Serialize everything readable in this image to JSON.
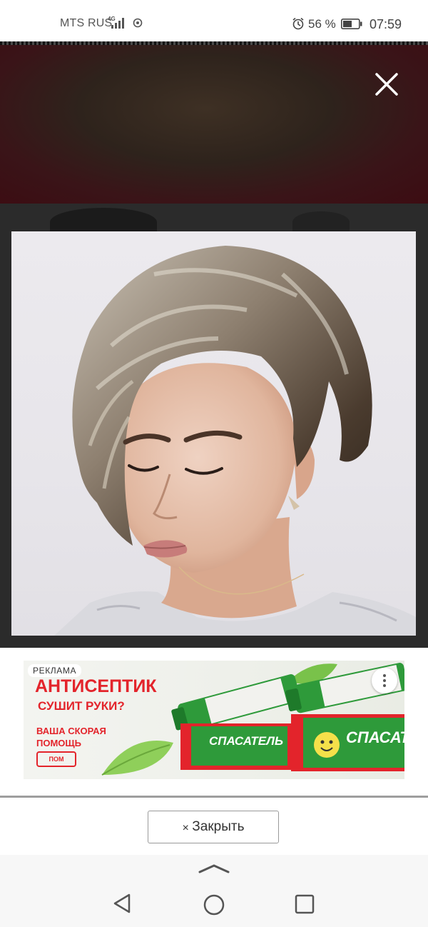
{
  "status_bar": {
    "carrier": "MTS RUS",
    "network": "4G",
    "battery_percent": "56 %",
    "battery_level": 56,
    "time": "07:59",
    "icons": [
      "signal-icon",
      "hotspot-icon",
      "alarm-icon",
      "battery-icon"
    ]
  },
  "viewer": {
    "close_icon": "close-icon",
    "photo_description_icon": "photo"
  },
  "ad": {
    "label": "РЕКЛАМА",
    "headline": "АНТИСЕПТИК",
    "question": "СУШИТ РУКИ?",
    "tagline": "ВАША СКОРАЯ ПОМОЩЬ",
    "product_name": "СПАСАТЕЛЬ",
    "brand_colors": {
      "red": "#e3242b",
      "green": "#2e9a3a"
    },
    "menu_icon": "more-vert-icon"
  },
  "close_button": {
    "icon": "×",
    "label": "Закрыть"
  },
  "nav_bar": {
    "items": [
      "back-icon",
      "home-icon",
      "recents-icon"
    ],
    "handle_icon": "chevron-up-icon"
  }
}
